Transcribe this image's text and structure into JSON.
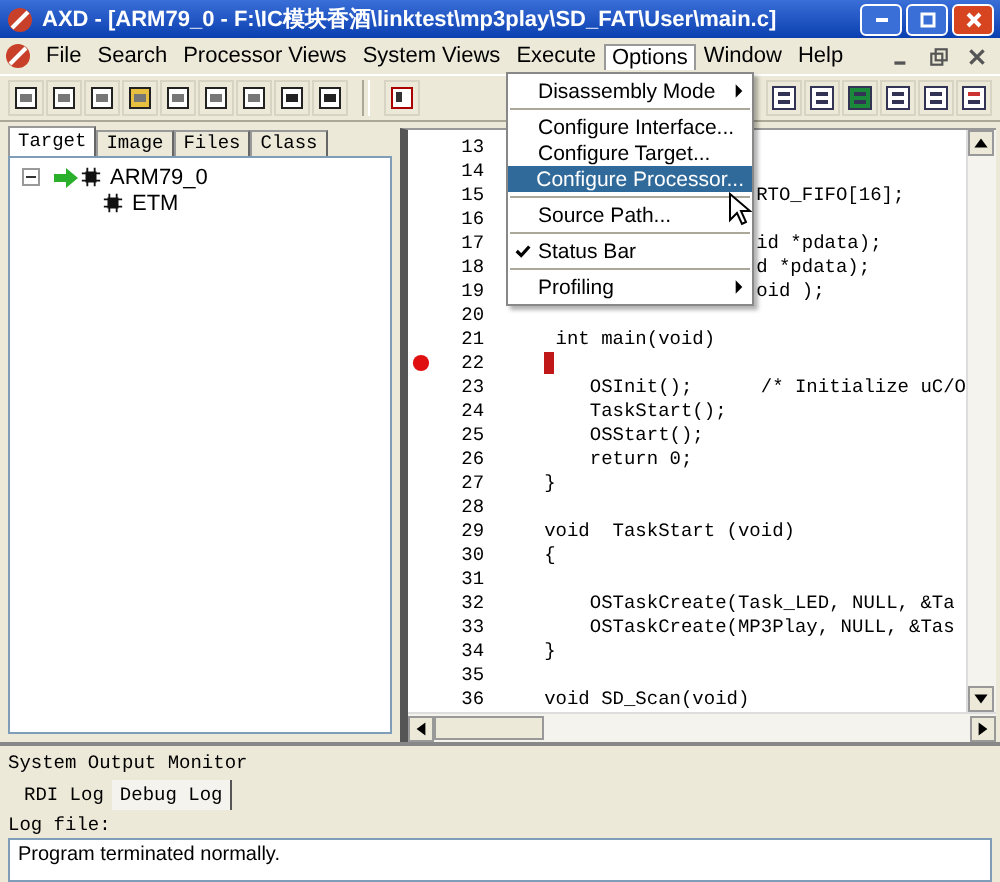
{
  "window": {
    "title": "AXD - [ARM79_0 - F:\\IC模块香酒\\linktest\\mp3play\\SD_FAT\\User\\main.c]"
  },
  "menu_bar": [
    {
      "label": "File",
      "selected": false
    },
    {
      "label": "Search",
      "selected": false
    },
    {
      "label": "Processor Views",
      "selected": false
    },
    {
      "label": "System Views",
      "selected": false
    },
    {
      "label": "Execute",
      "selected": false
    },
    {
      "label": "Options",
      "selected": true
    },
    {
      "label": "Window",
      "selected": false
    },
    {
      "label": "Help",
      "selected": false
    }
  ],
  "options_menu": [
    [
      {
        "label": "Disassembly Mode",
        "submenu": true,
        "checked": false,
        "selected": false
      }
    ],
    [
      {
        "label": "Configure Interface...",
        "submenu": false,
        "checked": false,
        "selected": false
      },
      {
        "label": "Configure Target...",
        "submenu": false,
        "checked": false,
        "selected": false
      },
      {
        "label": "Configure Processor...",
        "submenu": false,
        "checked": false,
        "selected": true
      }
    ],
    [
      {
        "label": "Source Path...",
        "submenu": false,
        "checked": false,
        "selected": false
      }
    ],
    [
      {
        "label": "Status Bar",
        "submenu": false,
        "checked": true,
        "selected": false
      }
    ],
    [
      {
        "label": "Profiling",
        "submenu": true,
        "checked": false,
        "selected": false
      }
    ]
  ],
  "left_tabs": [
    {
      "label": "Target",
      "selected": true
    },
    {
      "label": "Image",
      "selected": false
    },
    {
      "label": "Files",
      "selected": false
    },
    {
      "label": "Class",
      "selected": false
    }
  ],
  "tree": [
    {
      "label": "ARM79_0",
      "expanded": true,
      "children": [
        {
          "label": "ETM"
        }
      ]
    }
  ],
  "code_lines": [
    {
      "number": "13",
      "breakpoint": false
    },
    {
      "number": "14",
      "breakpoint": false
    },
    {
      "number": "15",
      "text": "RTO_FIFO[16];",
      "breakpoint": false,
      "covered": true
    },
    {
      "number": "16",
      "breakpoint": false
    },
    {
      "number": "17",
      "text": "id *pdata);",
      "breakpoint": false,
      "covered": true
    },
    {
      "number": "18",
      "text": "d *pdata);",
      "breakpoint": false,
      "covered": true
    },
    {
      "number": "19",
      "text": "oid );",
      "breakpoint": false,
      "covered": true
    },
    {
      "number": "20",
      "breakpoint": false
    },
    {
      "number": "21",
      "text": " int main(void)",
      "breakpoint": false,
      "covered": false
    },
    {
      "number": "22",
      "breakpoint": true
    },
    {
      "number": "23",
      "text": "    OSInit();      /* Initialize uC/O",
      "breakpoint": false,
      "covered": false
    },
    {
      "number": "24",
      "text": "    TaskStart();",
      "breakpoint": false,
      "covered": false
    },
    {
      "number": "25",
      "text": "    OSStart();",
      "breakpoint": false,
      "covered": false
    },
    {
      "number": "26",
      "text": "    return 0;",
      "breakpoint": false,
      "covered": false
    },
    {
      "number": "27",
      "text": "}",
      "breakpoint": false,
      "covered": false
    },
    {
      "number": "28",
      "breakpoint": false
    },
    {
      "number": "29",
      "text": "void  TaskStart (void)",
      "breakpoint": false,
      "covered": false
    },
    {
      "number": "30",
      "text": "{",
      "breakpoint": false,
      "covered": false
    },
    {
      "number": "31",
      "breakpoint": false
    },
    {
      "number": "32",
      "text": "    OSTaskCreate(Task_LED, NULL, &Ta",
      "breakpoint": false,
      "covered": false
    },
    {
      "number": "33",
      "text": "    OSTaskCreate(MP3Play, NULL, &Tas",
      "breakpoint": false,
      "covered": false
    },
    {
      "number": "34",
      "text": "}",
      "breakpoint": false,
      "covered": false
    },
    {
      "number": "35",
      "breakpoint": false
    },
    {
      "number": "36",
      "text": "void SD_Scan(void)",
      "breakpoint": false,
      "covered": false
    }
  ],
  "output_monitor": {
    "title": "System Output Monitor",
    "tabs": [
      {
        "label": "RDI Log",
        "selected": false
      },
      {
        "label": "Debug Log",
        "selected": true
      }
    ],
    "log_label": "Log file:",
    "log_text": "Program terminated normally."
  }
}
